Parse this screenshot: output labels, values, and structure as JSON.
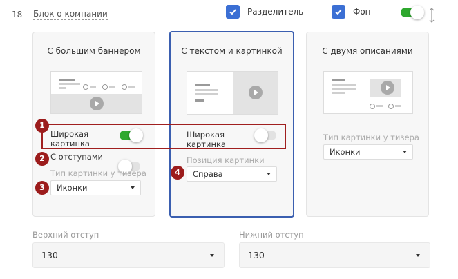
{
  "header": {
    "row_number": "18",
    "block_title": "Блок о компании",
    "divider_label": "Разделитель",
    "background_label": "Фон"
  },
  "cards": [
    {
      "title": "С большим баннером",
      "wide_image_label": "Широкая картинка",
      "padding_label": "С отступами",
      "teaser_type_label": "Тип картинки у тизера",
      "teaser_type_value": "Иконки"
    },
    {
      "title": "С текстом и картинкой",
      "wide_image_label": "Широкая картинка",
      "position_label": "Позиция картинки",
      "position_value": "Справа"
    },
    {
      "title": "С двумя описаниями",
      "teaser_type_label": "Тип картинки у тизера",
      "teaser_type_value": "Иконки"
    }
  ],
  "badges": [
    "1",
    "2",
    "3",
    "4"
  ],
  "paddings": {
    "top_label": "Верхний отступ",
    "top_value": "130",
    "bottom_label": "Нижний отступ",
    "bottom_value": "130"
  },
  "colors": {
    "checkbox": "#3b6fd4",
    "toggle_on": "#2ea82e",
    "selected_border": "#3b5fb0",
    "badge": "#9c1c1c"
  }
}
